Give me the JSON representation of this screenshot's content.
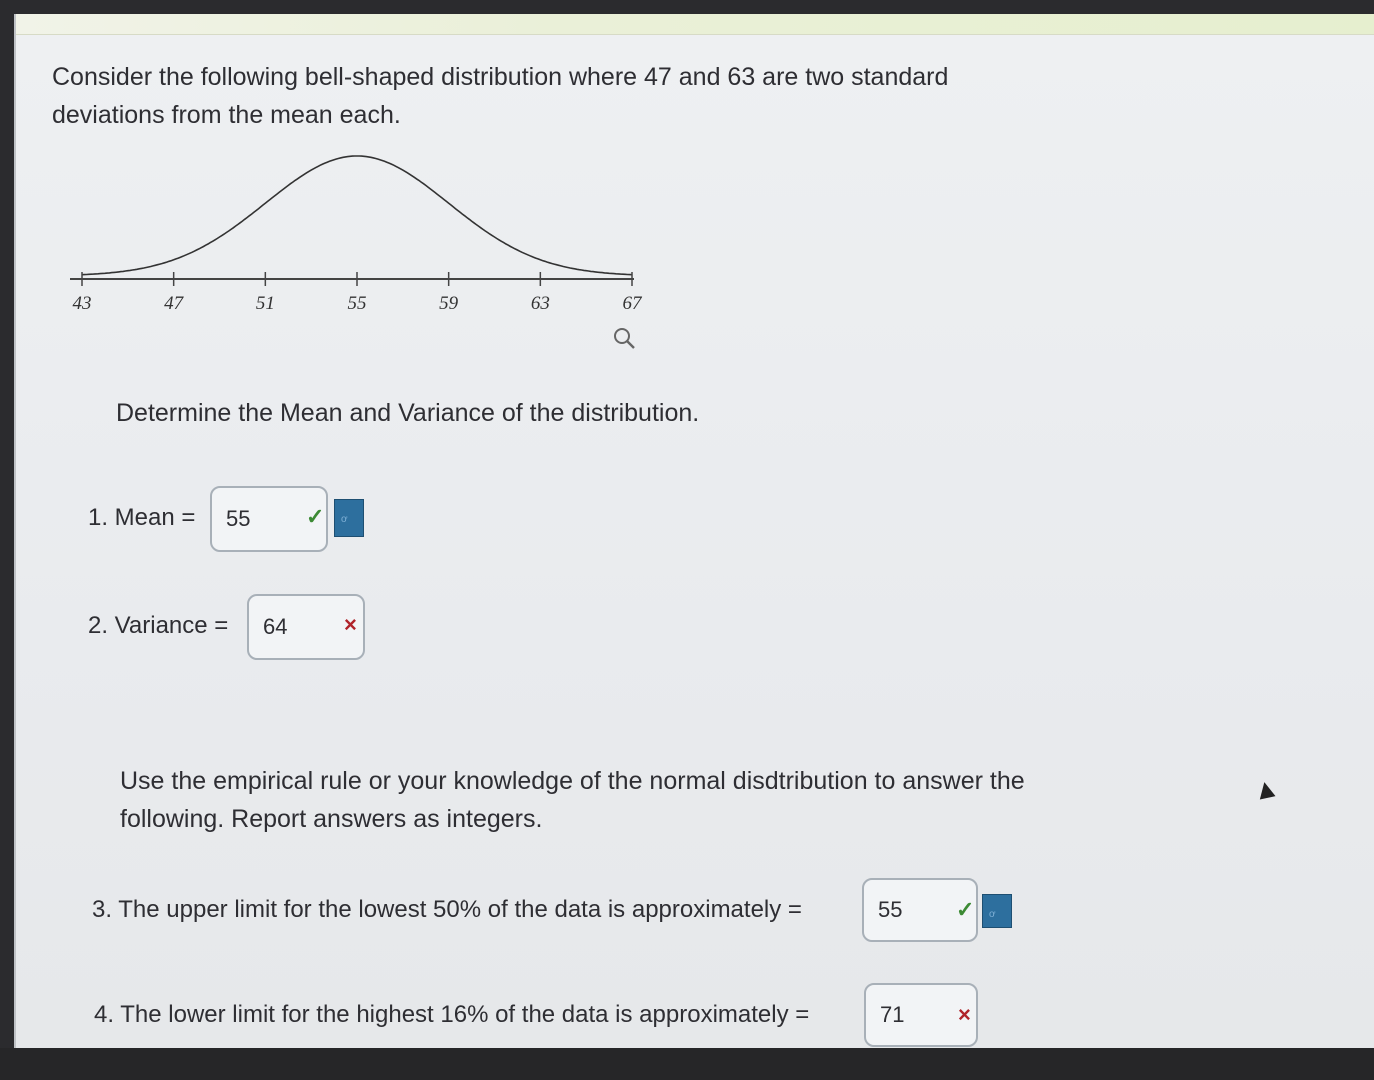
{
  "intro_text": "Consider the following bell-shaped distribution where 47 and 63 are two standard deviations from the mean each.",
  "chart_data": {
    "type": "line",
    "x_ticks": [
      "43",
      "47",
      "51",
      "55",
      "59",
      "63",
      "67"
    ],
    "x_range": [
      43,
      67
    ],
    "curve": "normal",
    "mean": 55,
    "sd": 4,
    "ylabel": "",
    "xlabel": ""
  },
  "zoom_icon": "magnifier-icon",
  "prompt_1": "Determine the Mean and Variance of the distribution.",
  "questions": [
    {
      "label": "1. Mean =",
      "value": "55",
      "status": "correct"
    },
    {
      "label": "2. Variance =",
      "value": "64",
      "status": "incorrect"
    },
    {
      "label": "3. The upper limit for the lowest 50% of the data is approximately =",
      "value": "55",
      "status": "correct"
    },
    {
      "label": "4. The lower limit for the highest 16% of the data is approximately =",
      "value": "71",
      "status": "incorrect"
    }
  ],
  "prompt_2": "Use the empirical rule or your knowledge of the normal disdtribution to answer the following. Report answers as integers.",
  "marks": {
    "correct": "✓",
    "incorrect": "×"
  },
  "colors": {
    "correct": "#3c8a34",
    "incorrect": "#b0232a",
    "info_button": "#2d6f9e"
  }
}
